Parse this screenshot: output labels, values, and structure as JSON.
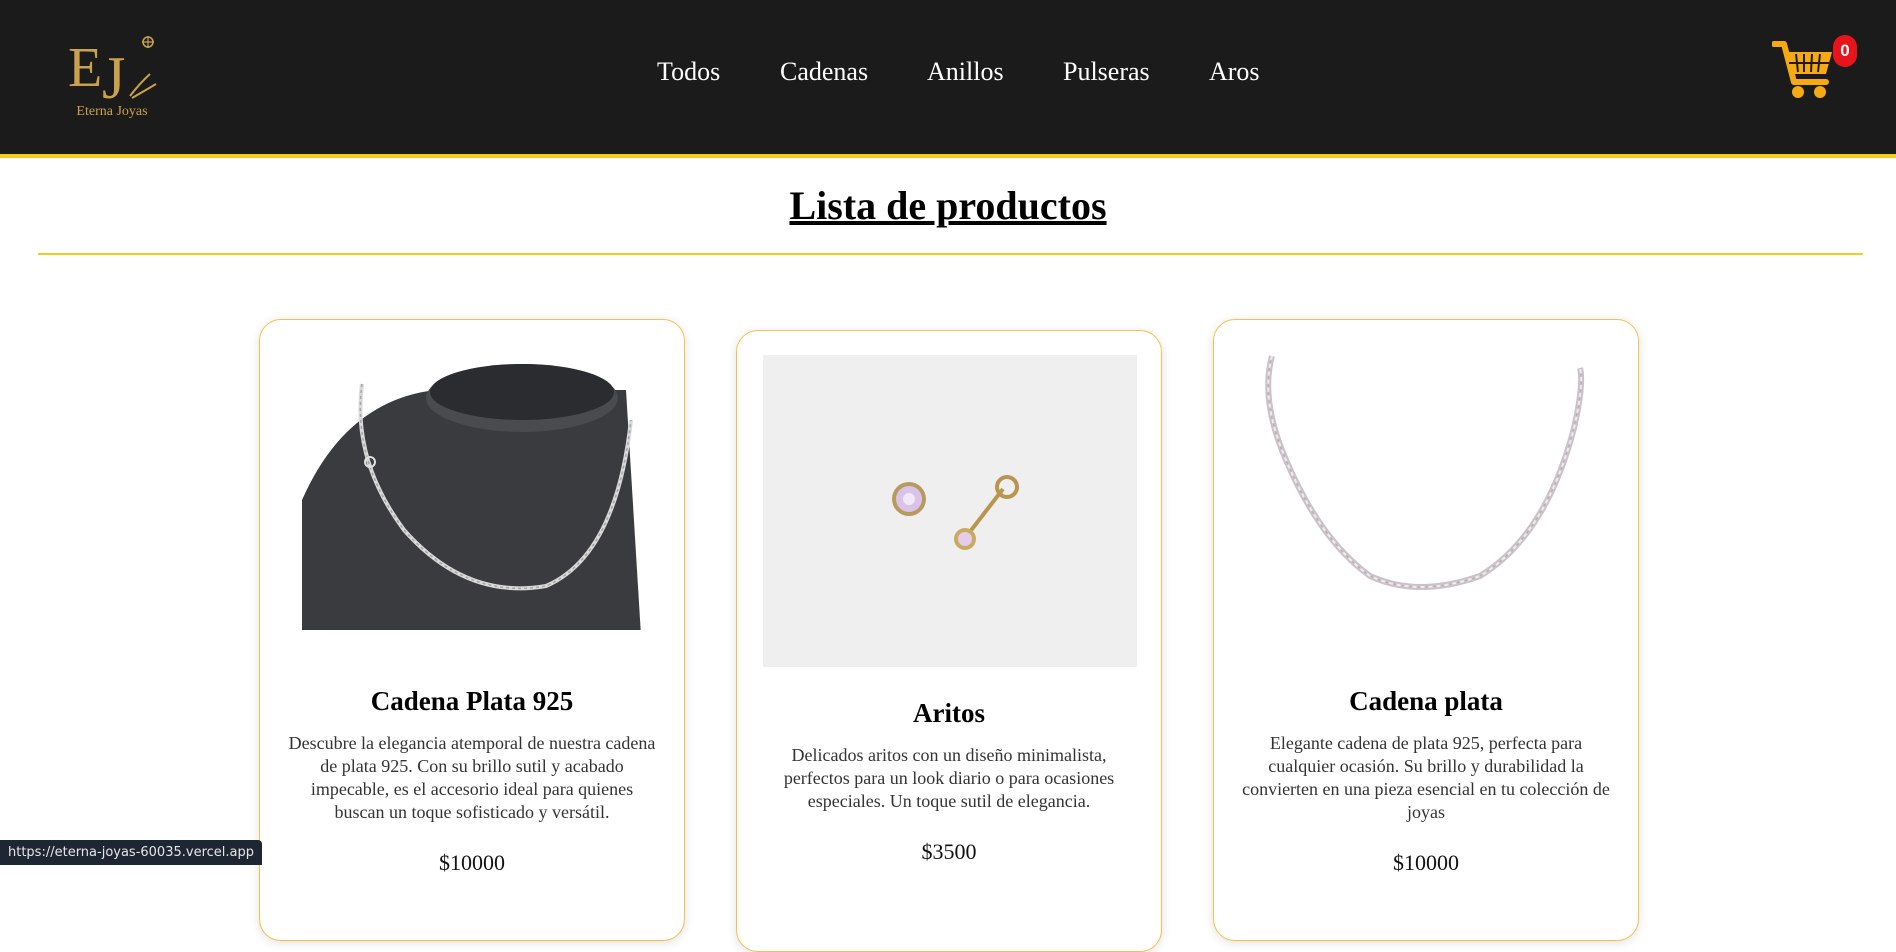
{
  "header": {
    "logo_monogram": "EJ",
    "logo_text": "Eterna Joyas",
    "nav": [
      {
        "label": "Todos"
      },
      {
        "label": "Cadenas"
      },
      {
        "label": "Anillos"
      },
      {
        "label": "Pulseras"
      },
      {
        "label": "Aros"
      }
    ],
    "cart_count": "0",
    "cart_icon": "shopping-cart-icon"
  },
  "main": {
    "title": "Lista de productos"
  },
  "products": [
    {
      "name": "Cadena Plata 925",
      "description": "Descubre la elegancia atemporal de nuestra cadena de plata 925. Con su brillo sutil y acabado impecable, es el accesorio ideal para quienes buscan un toque sofisticado y versátil.",
      "price": "$10000"
    },
    {
      "name": "Aritos",
      "description": "Delicados aritos con un diseño minimalista, perfectos para un look diario o para ocasiones especiales. Un toque sutil de elegancia.",
      "price": "$3500"
    },
    {
      "name": "Cadena plata",
      "description": "Elegante cadena de plata 925, perfecta para cualquier ocasión. Su brillo y durabilidad la convierten en una pieza esencial en tu colección de joyas",
      "price": "$10000"
    }
  ],
  "status_bar": {
    "url": "https://eterna-joyas-60035.vercel.app"
  },
  "colors": {
    "header_bg": "#1b1b1b",
    "accent_yellow": "#f3cc1c",
    "cart_orange": "#f5a912",
    "badge_red": "#e8141c",
    "logo_gold": "#c9a24d"
  }
}
